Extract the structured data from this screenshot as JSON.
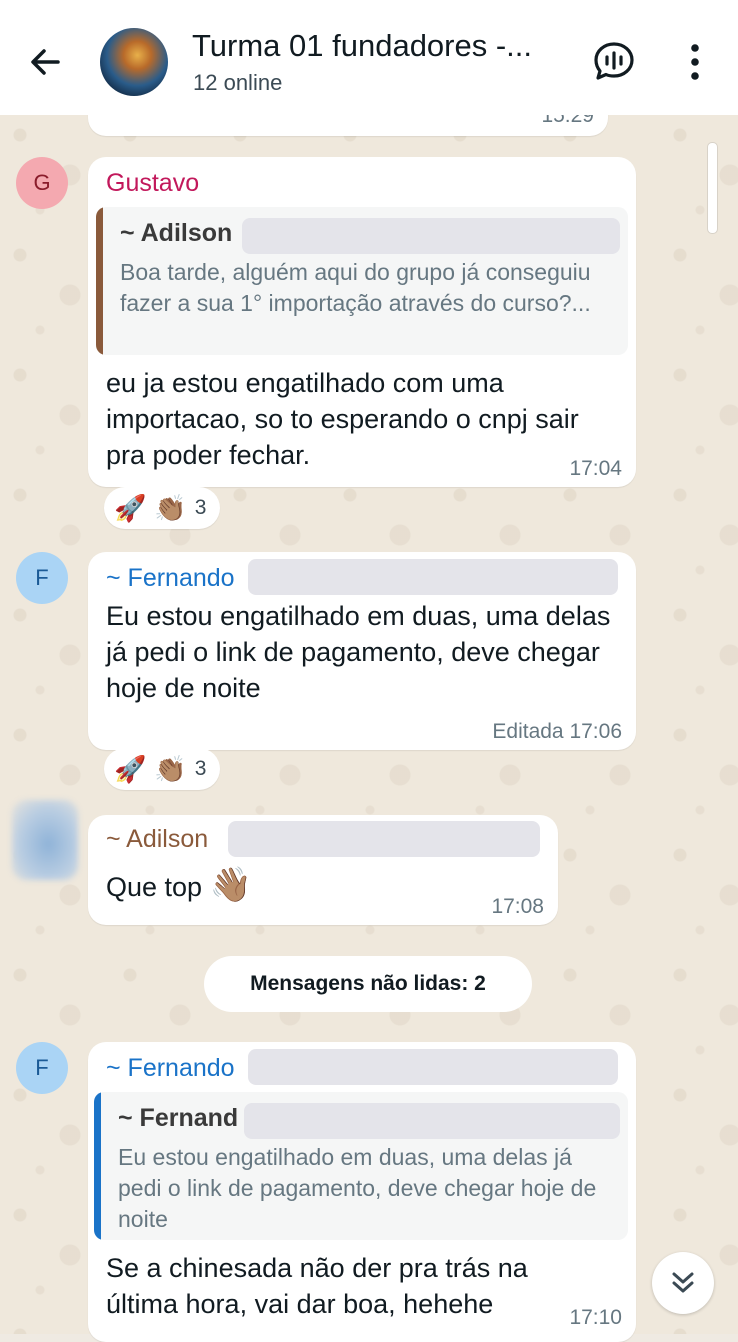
{
  "header": {
    "title": "Turma 01 fundadores  -...",
    "subtitle": "12 online"
  },
  "icons": {
    "back": "arrow-left-icon",
    "voice_chat": "voice-chat-icon",
    "menu": "more-vertical-icon",
    "scroll_down": "double-chevron-down-icon"
  },
  "colors": {
    "gustavo_name": "#c2185b",
    "fernando_name": "#1a73c8",
    "adilson_name": "#8a5a3b",
    "quote_bar_brown": "#8a5a3b",
    "quote_bar_blue": "#1a73c8"
  },
  "messages": {
    "prev_time": "15:29",
    "m1": {
      "avatar_letter": "G",
      "sender": "Gustavo",
      "quote_name": "~ Adilson",
      "quote_text": "Boa tarde, alguém aqui do grupo já conseguiu fazer a sua 1° importação através do curso?...",
      "text": "eu ja estou engatilhado com uma importacao, so to esperando o cnpj sair pra poder fechar.",
      "time": "17:04",
      "reaction_count": "3"
    },
    "m2": {
      "avatar_letter": "F",
      "sender": "~ Fernando",
      "text": "Eu estou engatilhado em duas, uma delas já pedi o link de pagamento, deve chegar hoje de noite",
      "time": "Editada 17:06",
      "reaction_count": "3"
    },
    "m3": {
      "sender": "~ Adilson",
      "text": "Que top",
      "emoji": "👋🏽",
      "time": "17:08"
    },
    "unread": "Mensagens não lidas: 2",
    "m4": {
      "avatar_letter": "F",
      "sender": "~ Fernando",
      "quote_name": "~ Fernand",
      "quote_text": "Eu estou engatilhado em duas, uma delas já pedi o link de pagamento, deve chegar hoje de noite",
      "text": "Se a chinesada não der pra trás na última hora, vai dar boa, hehehe",
      "time": "17:10"
    }
  },
  "reaction_emojis": [
    "🚀",
    "👏🏽"
  ]
}
